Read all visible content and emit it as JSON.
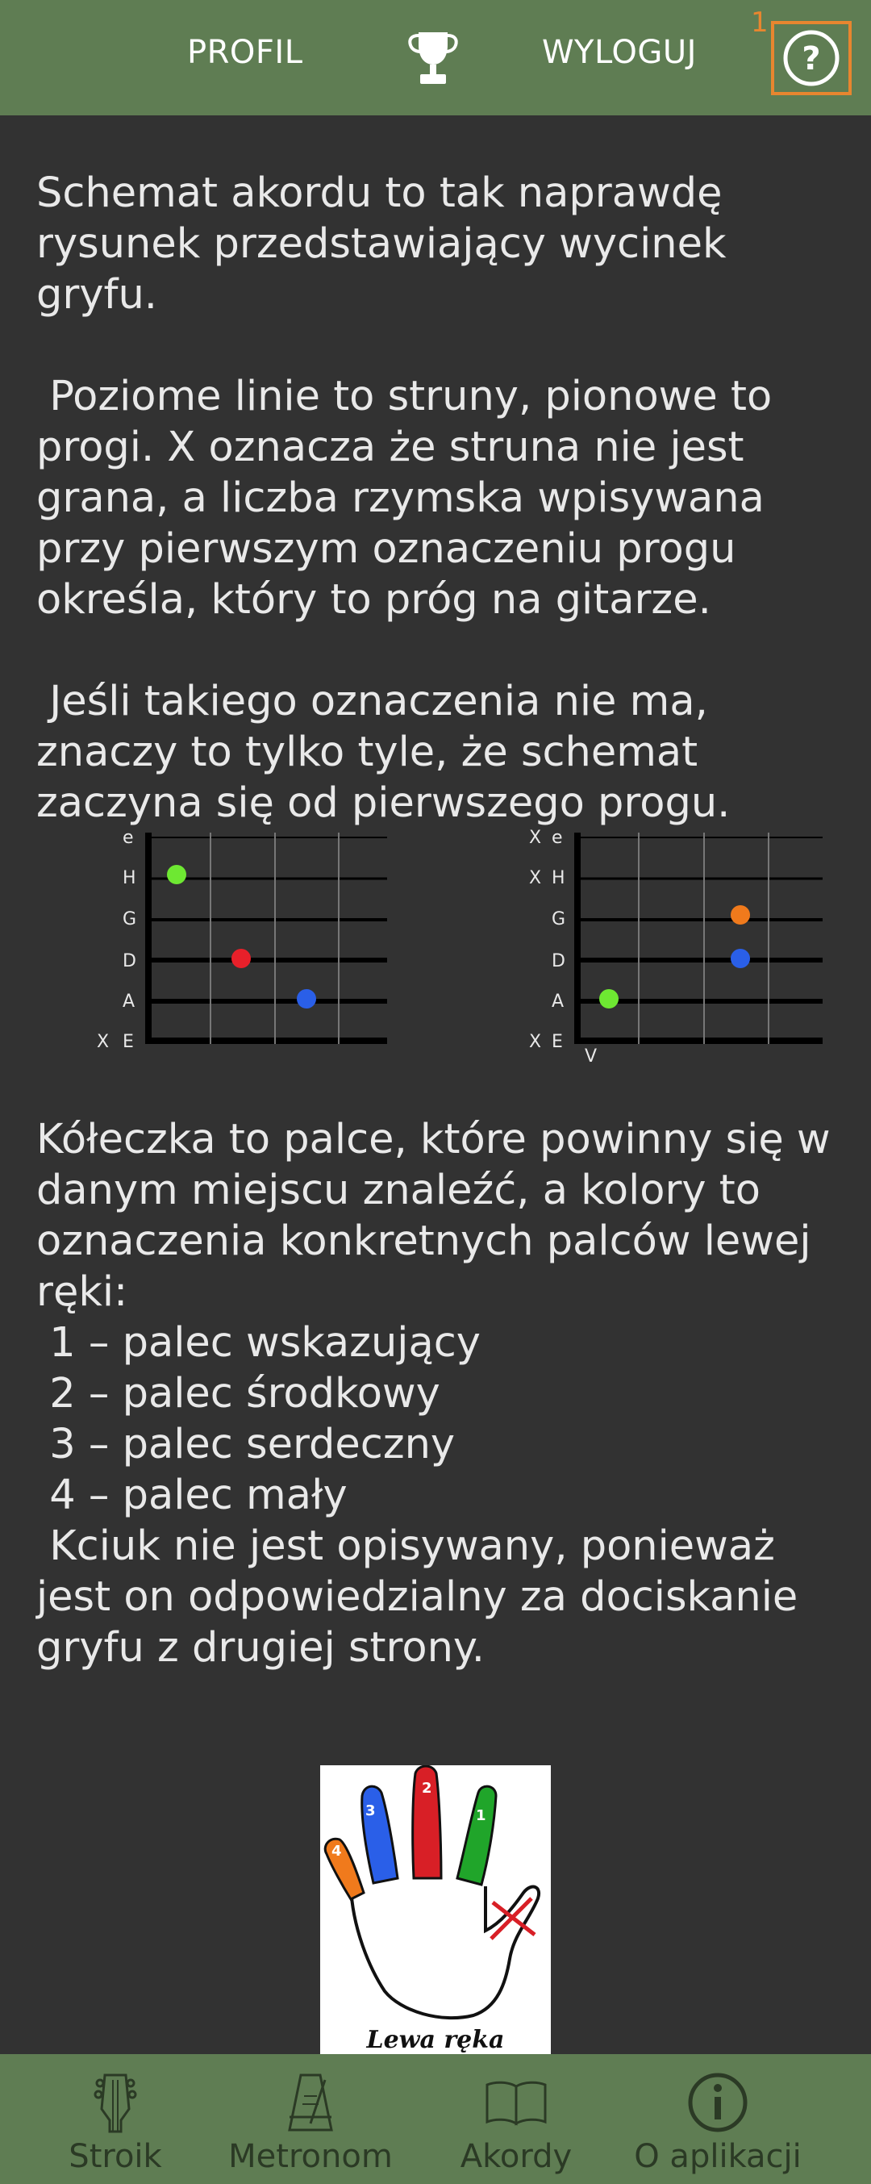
{
  "header": {
    "profile_label": "PROFIL",
    "logout_label": "WYLOGUJ",
    "help_badge": "1",
    "help_symbol": "?",
    "trophy_icon": "trophy-icon",
    "accent_color": "#e8862f",
    "bar_color": "#5f7d53"
  },
  "content": {
    "p1": "Schemat akordu to tak naprawdę rysunek przedstawiający wycinek gryfu.",
    "p2": " Poziome linie to struny, pionowe to progi. X oznacza że struna nie jest grana, a liczba rzymska wpisywana przy pierwszym oznaczeniu progu określa, który to próg na gitarze.",
    "p3": " Jeśli takiego oznaczenia nie ma, znaczy to tylko tyle, że schemat zaczyna się od pierwszego progu.",
    "p4": "Kółeczka to palce, które powinny się w danym miejscu znaleźć, a kolory to oznaczenia konkretnych palców lewej ręki:",
    "fingers": [
      " 1 – palec wskazujący",
      " 2 – palec środkowy",
      " 3 – palec serdeczny",
      " 4 – palec mały"
    ],
    "p5": " Kciuk nie jest opisywany, ponieważ jest on odpowiedzialny za dociskanie gryfu z drugiej strony."
  },
  "diagrams": {
    "left": {
      "strings": [
        "e",
        "H",
        "G",
        "D",
        "A",
        "E"
      ],
      "muted": [
        "",
        "",
        "",
        "",
        "",
        "X"
      ],
      "fret_label": ""
    },
    "right": {
      "strings": [
        "e",
        "H",
        "G",
        "D",
        "A",
        "E"
      ],
      "muted": [
        "X",
        "X",
        "",
        "",
        "",
        "X"
      ],
      "fret_label": "V"
    },
    "finger_colors": {
      "1": "#6ee832",
      "2": "#e8202a",
      "3": "#2a5fe8",
      "4": "#f07a1c"
    }
  },
  "hand_image": {
    "caption": "Lewa ręka",
    "finger_numbers": [
      "4",
      "3",
      "2",
      "1"
    ]
  },
  "bottom_nav": {
    "items": [
      {
        "label": "Stroik",
        "icon": "tuner-headstock-icon"
      },
      {
        "label": "Metronom",
        "icon": "metronome-icon"
      },
      {
        "label": "Akordy",
        "icon": "book-icon"
      },
      {
        "label": "O aplikacji",
        "icon": "info-icon"
      }
    ]
  }
}
